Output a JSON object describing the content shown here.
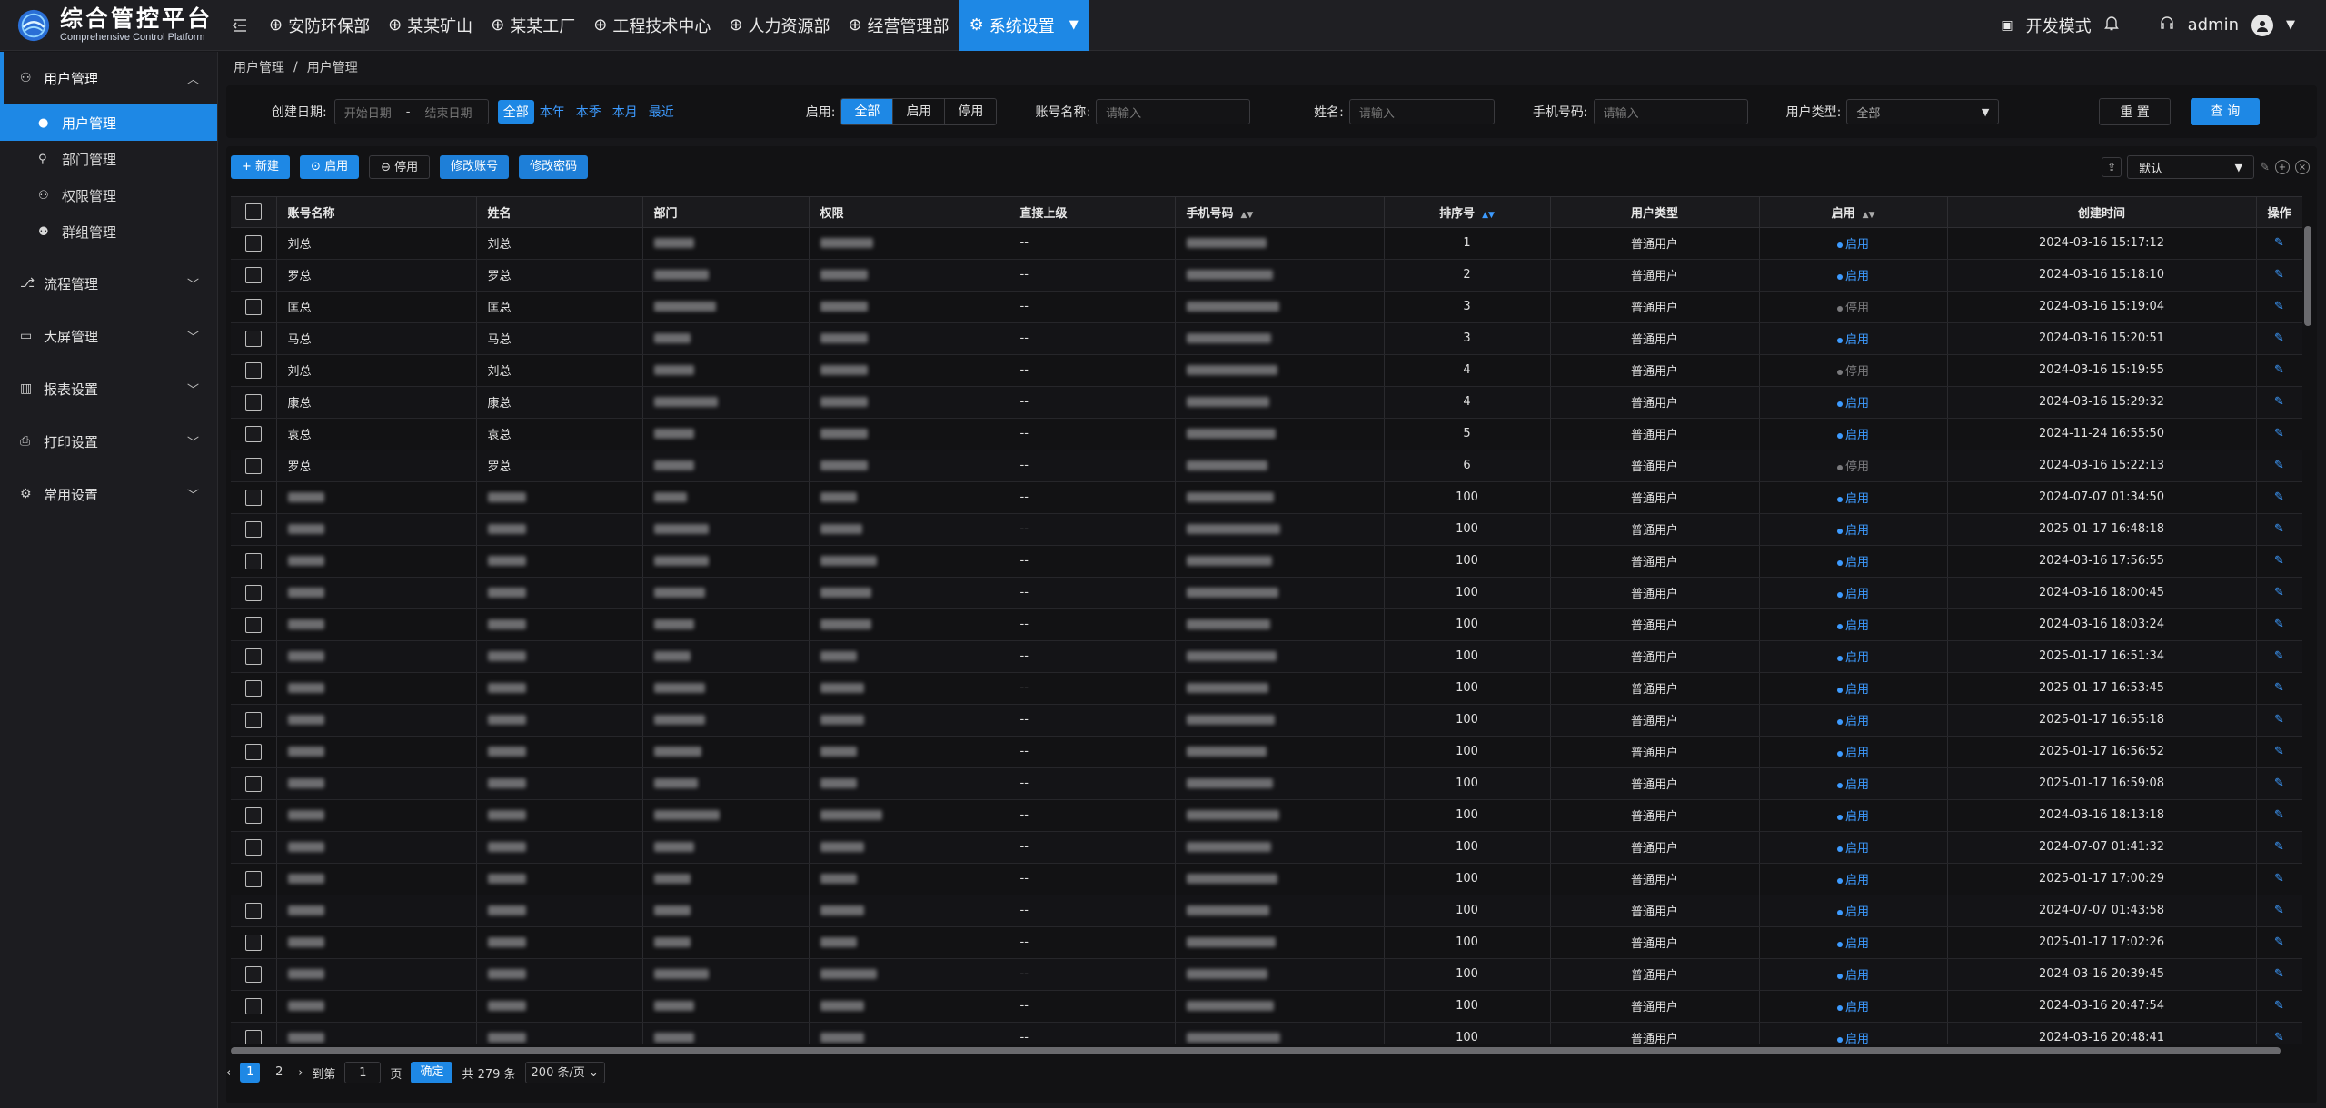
{
  "app": {
    "title": "综合管控平台",
    "subtitle": "Comprehensive Control Platform"
  },
  "topnav": [
    {
      "label": "安防环保部",
      "icon": "globe-icon"
    },
    {
      "label": "某某矿山",
      "icon": "globe-icon"
    },
    {
      "label": "某某工厂",
      "icon": "globe-icon"
    },
    {
      "label": "工程技术中心",
      "icon": "globe-icon"
    },
    {
      "label": "人力资源部",
      "icon": "globe-icon"
    },
    {
      "label": "经营管理部",
      "icon": "globe-icon"
    },
    {
      "label": "系统设置",
      "icon": "gear-icon",
      "active": true
    }
  ],
  "topright": {
    "dev_mode": "开发模式",
    "user": "admin"
  },
  "sidebar": {
    "groups": [
      {
        "label": "用户管理",
        "open": true,
        "items": [
          "用户管理",
          "部门管理",
          "权限管理",
          "群组管理"
        ]
      },
      {
        "label": "流程管理"
      },
      {
        "label": "大屏管理"
      },
      {
        "label": "报表设置"
      },
      {
        "label": "打印设置"
      },
      {
        "label": "常用设置"
      }
    ]
  },
  "breadcrumb": [
    "用户管理",
    "用户管理"
  ],
  "filter": {
    "created_label": "创建日期:",
    "start_placeholder": "开始日期",
    "end_placeholder": "结束日期",
    "date_range_sep": "-",
    "quick_ranges": [
      "全部",
      "本年",
      "本季",
      "本月",
      "最近"
    ],
    "enable_label": "启用:",
    "enable_options": [
      "全部",
      "启用",
      "停用"
    ],
    "account_label": "账号名称:",
    "account_placeholder": "请输入",
    "name_label": "姓名:",
    "name_placeholder": "请输入",
    "phone_label": "手机号码:",
    "phone_placeholder": "请输入",
    "usertype_label": "用户类型:",
    "usertype_value": "全部",
    "reset": "重 置",
    "query": "查 询"
  },
  "toolbar": {
    "new": "新建",
    "enable": "启用",
    "disable": "停用",
    "edit_account": "修改账号",
    "edit_password": "修改密码",
    "view": "默认"
  },
  "table": {
    "columns": [
      "账号名称",
      "姓名",
      "部门",
      "权限",
      "直接上级",
      "手机号码",
      "排序号",
      "用户类型",
      "启用",
      "创建时间",
      "操作"
    ],
    "rows": [
      {
        "account": "刘总",
        "name": "刘总",
        "sup": "--",
        "sort": "1",
        "type": "普通用户",
        "status": "启用",
        "on": true,
        "time": "2024-03-16 15:17:12"
      },
      {
        "account": "罗总",
        "name": "罗总",
        "sup": "--",
        "sort": "2",
        "type": "普通用户",
        "status": "启用",
        "on": true,
        "time": "2024-03-16 15:18:10"
      },
      {
        "account": "匡总",
        "name": "匡总",
        "sup": "--",
        "sort": "3",
        "type": "普通用户",
        "status": "停用",
        "on": false,
        "time": "2024-03-16 15:19:04"
      },
      {
        "account": "马总",
        "name": "马总",
        "sup": "--",
        "sort": "3",
        "type": "普通用户",
        "status": "启用",
        "on": true,
        "time": "2024-03-16 15:20:51"
      },
      {
        "account": "刘总",
        "name": "刘总",
        "sup": "--",
        "sort": "4",
        "type": "普通用户",
        "status": "停用",
        "on": false,
        "time": "2024-03-16 15:19:55"
      },
      {
        "account": "康总",
        "name": "康总",
        "sup": "--",
        "sort": "4",
        "type": "普通用户",
        "status": "启用",
        "on": true,
        "time": "2024-03-16 15:29:32"
      },
      {
        "account": "袁总",
        "name": "袁总",
        "sup": "--",
        "sort": "5",
        "type": "普通用户",
        "status": "启用",
        "on": true,
        "time": "2024-11-24 16:55:50"
      },
      {
        "account": "罗总",
        "name": "罗总",
        "sup": "--",
        "sort": "6",
        "type": "普通用户",
        "status": "停用",
        "on": false,
        "time": "2024-03-16 15:22:13"
      },
      {
        "account": "",
        "name": "",
        "sup": "--",
        "sort": "100",
        "type": "普通用户",
        "status": "启用",
        "on": true,
        "time": "2024-07-07 01:34:50"
      },
      {
        "account": "",
        "name": "",
        "sup": "--",
        "sort": "100",
        "type": "普通用户",
        "status": "启用",
        "on": true,
        "time": "2025-01-17 16:48:18"
      },
      {
        "account": "",
        "name": "",
        "sup": "--",
        "sort": "100",
        "type": "普通用户",
        "status": "启用",
        "on": true,
        "time": "2024-03-16 17:56:55"
      },
      {
        "account": "",
        "name": "",
        "sup": "--",
        "sort": "100",
        "type": "普通用户",
        "status": "启用",
        "on": true,
        "time": "2024-03-16 18:00:45"
      },
      {
        "account": "",
        "name": "",
        "sup": "--",
        "sort": "100",
        "type": "普通用户",
        "status": "启用",
        "on": true,
        "time": "2024-03-16 18:03:24"
      },
      {
        "account": "",
        "name": "",
        "sup": "--",
        "sort": "100",
        "type": "普通用户",
        "status": "启用",
        "on": true,
        "time": "2025-01-17 16:51:34"
      },
      {
        "account": "",
        "name": "",
        "sup": "--",
        "sort": "100",
        "type": "普通用户",
        "status": "启用",
        "on": true,
        "time": "2025-01-17 16:53:45"
      },
      {
        "account": "",
        "name": "",
        "sup": "--",
        "sort": "100",
        "type": "普通用户",
        "status": "启用",
        "on": true,
        "time": "2025-01-17 16:55:18"
      },
      {
        "account": "",
        "name": "",
        "sup": "--",
        "sort": "100",
        "type": "普通用户",
        "status": "启用",
        "on": true,
        "time": "2025-01-17 16:56:52"
      },
      {
        "account": "",
        "name": "",
        "sup": "--",
        "sort": "100",
        "type": "普通用户",
        "status": "启用",
        "on": true,
        "time": "2025-01-17 16:59:08"
      },
      {
        "account": "",
        "name": "",
        "sup": "--",
        "sort": "100",
        "type": "普通用户",
        "status": "启用",
        "on": true,
        "time": "2024-03-16 18:13:18"
      },
      {
        "account": "",
        "name": "",
        "sup": "--",
        "sort": "100",
        "type": "普通用户",
        "status": "启用",
        "on": true,
        "time": "2024-07-07 01:41:32"
      },
      {
        "account": "",
        "name": "",
        "sup": "--",
        "sort": "100",
        "type": "普通用户",
        "status": "启用",
        "on": true,
        "time": "2025-01-17 17:00:29"
      },
      {
        "account": "",
        "name": "",
        "sup": "--",
        "sort": "100",
        "type": "普通用户",
        "status": "启用",
        "on": true,
        "time": "2024-07-07 01:43:58"
      },
      {
        "account": "",
        "name": "",
        "sup": "--",
        "sort": "100",
        "type": "普通用户",
        "status": "启用",
        "on": true,
        "time": "2025-01-17 17:02:26"
      },
      {
        "account": "",
        "name": "",
        "sup": "--",
        "sort": "100",
        "type": "普通用户",
        "status": "启用",
        "on": true,
        "time": "2024-03-16 20:39:45"
      },
      {
        "account": "",
        "name": "",
        "sup": "--",
        "sort": "100",
        "type": "普通用户",
        "status": "启用",
        "on": true,
        "time": "2024-03-16 20:47:54"
      },
      {
        "account": "",
        "name": "",
        "sup": "--",
        "sort": "100",
        "type": "普通用户",
        "status": "启用",
        "on": true,
        "time": "2024-03-16 20:48:41"
      }
    ]
  },
  "pager": {
    "pages": [
      "1",
      "2"
    ],
    "goto": "到第",
    "page_value": "1",
    "page_unit": "页",
    "ok": "确定",
    "total": "共 279 条",
    "size": "200 条/页"
  },
  "colors": {
    "accent": "#1e88e5",
    "link": "#3d9bff",
    "bg": "#17171a"
  }
}
